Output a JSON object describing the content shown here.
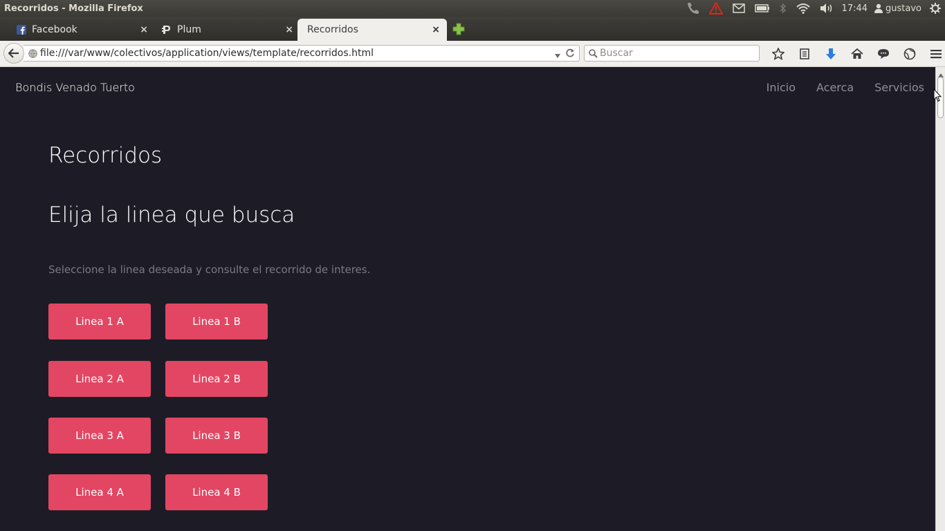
{
  "panel": {
    "window_title": "Recorridos - Mozilla Firefox",
    "clock": "17:44",
    "user": "gustavo"
  },
  "tabs": [
    {
      "label": "Facebook",
      "icon": "facebook-icon",
      "close": "×"
    },
    {
      "label": "Plum",
      "icon": "plum-icon",
      "close": "×"
    },
    {
      "label": "Recorridos",
      "icon": "",
      "close": "×"
    }
  ],
  "navbar": {
    "url": "file:///var/www/colectivos/application/views/template/recorridos.html",
    "search_placeholder": "Buscar"
  },
  "site": {
    "brand": "Bondis Venado Tuerto",
    "nav": [
      "Inicio",
      "Acerca",
      "Servicios"
    ],
    "page_title": "Recorridos",
    "section_heading": "Elija la linea que busca",
    "section_text": "Seleccione la linea deseada y consulte el recorrido de interes.",
    "lines": [
      [
        "Linea 1 A",
        "Linea 1 B"
      ],
      [
        "Linea 2 A",
        "Linea 2 B"
      ],
      [
        "Linea 3 A",
        "Linea 3 B"
      ],
      [
        "Linea 4 A",
        "Linea 4 B"
      ]
    ]
  },
  "colors": {
    "background": "#1d1c26",
    "button": "#e34663",
    "muted_text": "#7a7984"
  }
}
